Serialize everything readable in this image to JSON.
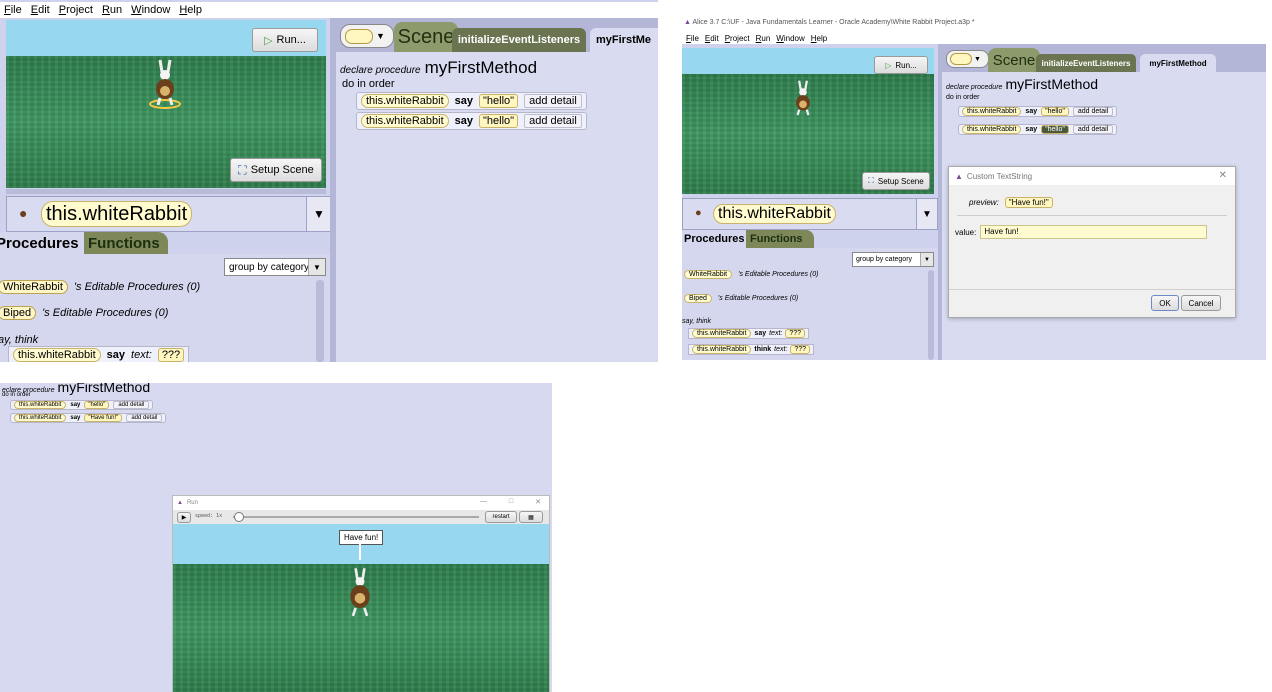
{
  "panelA": {
    "menu": [
      "File",
      "Edit",
      "Project",
      "Run",
      "Window",
      "Help"
    ],
    "run_button": "Run...",
    "setup_scene": "Setup Scene",
    "selected_object": "this.whiteRabbit",
    "tab_procedures": "Procedures",
    "tab_functions": "Functions",
    "group_by": "group by category",
    "editable_rows": [
      {
        "label": "WhiteRabbit",
        "text": "'s Editable Procedures (0)"
      },
      {
        "label": "Biped",
        "text": "'s Editable Procedures (0)"
      }
    ],
    "category_label": "ay, think",
    "say_row": {
      "obj": "this.whiteRabbit",
      "verb": "say",
      "param": "text:",
      "value": "???"
    },
    "tab_scene": "Scene",
    "tab_listeners": "initializeEventListeners",
    "tab_method": "myFirstMe",
    "declare_label": "declare procedure",
    "method_name": "myFirstMethod",
    "do_in_order": "do in order",
    "statements": [
      {
        "obj": "this.whiteRabbit",
        "verb": "say",
        "value": "\"hello\"",
        "detail": "add detail"
      },
      {
        "obj": "this.whiteRabbit",
        "verb": "say",
        "value": "\"hello\"",
        "detail": "add detail"
      }
    ]
  },
  "panelB": {
    "title": "Alice 3.7 C:\\UF - Java Fundamentals Learner - Oracle Academy\\White Rabbit Project.a3p *",
    "menu": [
      "File",
      "Edit",
      "Project",
      "Run",
      "Window",
      "Help"
    ],
    "run_button": "Run...",
    "setup_scene": "Setup Scene",
    "selected_object": "this.whiteRabbit",
    "tab_procedures": "Procedures",
    "tab_functions": "Functions",
    "group_by": "group by category",
    "editable_rows": [
      {
        "label": "WhiteRabbit",
        "text": "'s Editable Procedures (0)"
      },
      {
        "label": "Biped",
        "text": "'s Editable Procedures (0)"
      }
    ],
    "category_label": "say, think",
    "proc_rows": [
      {
        "obj": "this.whiteRabbit",
        "verb": "say",
        "param": "text:",
        "value": "???"
      },
      {
        "obj": "this.whiteRabbit",
        "verb": "think",
        "param": "text:",
        "value": "???"
      }
    ],
    "tab_scene": "Scene",
    "tab_listeners": "initializeEventListeners",
    "tab_method": "myFirstMethod",
    "declare_label": "declare procedure",
    "method_name": "myFirstMethod",
    "do_in_order": "do in order",
    "statements": [
      {
        "obj": "this.whiteRabbit",
        "verb": "say",
        "value": "\"hello\"",
        "detail": "add detail"
      },
      {
        "obj": "this.whiteRabbit",
        "verb": "say",
        "value": "\"hello\"",
        "detail": "add detail"
      }
    ],
    "dialog": {
      "title": "Custom TextString",
      "preview_label": "preview:",
      "preview_value": "\"Have fun!\"",
      "value_label": "value:",
      "value_text": "Have fun!",
      "ok": "OK",
      "cancel": "Cancel"
    }
  },
  "panelC": {
    "declare_label": "eclare procedure",
    "method_name": "myFirstMethod",
    "do_in_order": "do in order",
    "statements": [
      {
        "obj": "this.whiteRabbit",
        "verb": "say",
        "value": "\"hello\"",
        "detail": "add detail"
      },
      {
        "obj": "this.whiteRabbit",
        "verb": "say",
        "value": "\"Have fun!\"",
        "detail": "add detail"
      }
    ],
    "run_window": {
      "title": "Run",
      "speed_label": "speed: 1x",
      "speed_fraction": 0.02,
      "restart": "restart",
      "bubble_text": "Have fun!"
    }
  },
  "colors": {
    "lavender": "#d5d7ee",
    "sky": "#97d8f0",
    "grass": "#2f7f4f"
  }
}
